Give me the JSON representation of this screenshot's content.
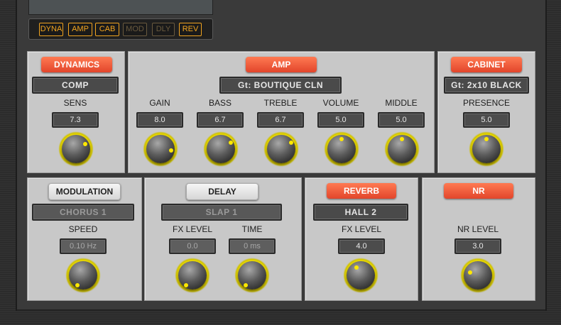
{
  "fx_buttons": [
    {
      "label": "DYNA",
      "active": true
    },
    {
      "label": "AMP",
      "active": true
    },
    {
      "label": "CAB",
      "active": true
    },
    {
      "label": "MOD",
      "active": false
    },
    {
      "label": "DLY",
      "active": false
    },
    {
      "label": "REV",
      "active": true
    }
  ],
  "dynamics": {
    "title": "DYNAMICS",
    "type": "COMP",
    "params": [
      {
        "label": "SENS",
        "value": "7.3"
      }
    ]
  },
  "amp": {
    "title": "AMP",
    "type": "Gt: BOUTIQUE CLN",
    "params": [
      {
        "label": "GAIN",
        "value": "8.0"
      },
      {
        "label": "BASS",
        "value": "6.7"
      },
      {
        "label": "TREBLE",
        "value": "6.7"
      },
      {
        "label": "VOLUME",
        "value": "5.0"
      },
      {
        "label": "MIDDLE",
        "value": "5.0"
      }
    ]
  },
  "cabinet": {
    "title": "CABINET",
    "type": "Gt: 2x10 BLACK",
    "params": [
      {
        "label": "PRESENCE",
        "value": "5.0"
      }
    ]
  },
  "modulation": {
    "title": "MODULATION",
    "type": "CHORUS 1",
    "params": [
      {
        "label": "SPEED",
        "value": "0.10 Hz"
      }
    ]
  },
  "delay": {
    "title": "DELAY",
    "type": "SLAP 1",
    "params": [
      {
        "label": "FX LEVEL",
        "value": "0.0"
      },
      {
        "label": "TIME",
        "value": "0 ms"
      }
    ]
  },
  "reverb": {
    "title": "REVERB",
    "type": "HALL 2",
    "params": [
      {
        "label": "FX LEVEL",
        "value": "4.0"
      }
    ]
  },
  "nr": {
    "title": "NR",
    "params": [
      {
        "label": "NR LEVEL",
        "value": "3.0"
      }
    ]
  },
  "colors": {
    "accent": "#e85a3a",
    "knob_ring": "#f2e000",
    "fx_active": "#f1a420"
  }
}
